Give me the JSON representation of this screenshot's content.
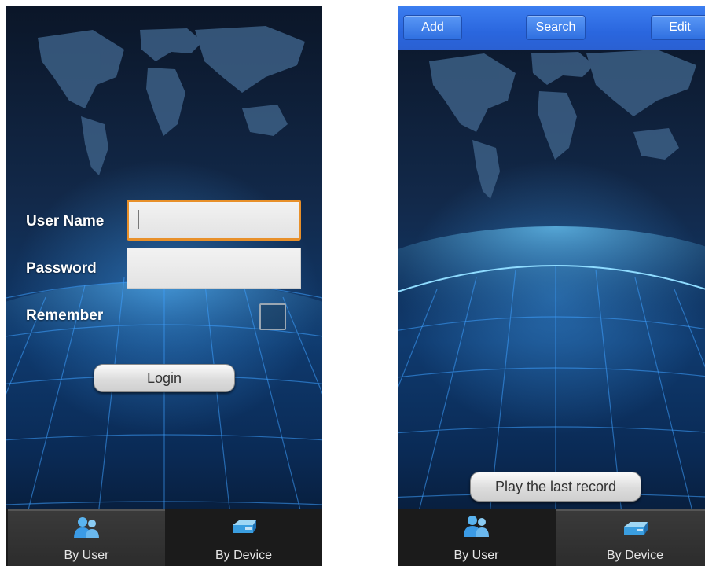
{
  "login_screen": {
    "form": {
      "username_label": "User Name",
      "username_value": "",
      "password_label": "Password",
      "password_value": "",
      "remember_label": "Remember",
      "remember_checked": false,
      "login_button": "Login"
    }
  },
  "list_screen": {
    "toolbar": {
      "add": "Add",
      "search": "Search",
      "edit": "Edit"
    },
    "play_last_record": "Play the last record"
  },
  "tabs": [
    {
      "label": "By User",
      "icon": "users-icon"
    },
    {
      "label": "By Device",
      "icon": "device-icon"
    }
  ],
  "login_active_tab": "By User",
  "list_active_tab": "By Device",
  "colors": {
    "focus_border": "#e8902a",
    "top_bar": "#2a66de",
    "tab_bar": "#1b1b1b"
  }
}
